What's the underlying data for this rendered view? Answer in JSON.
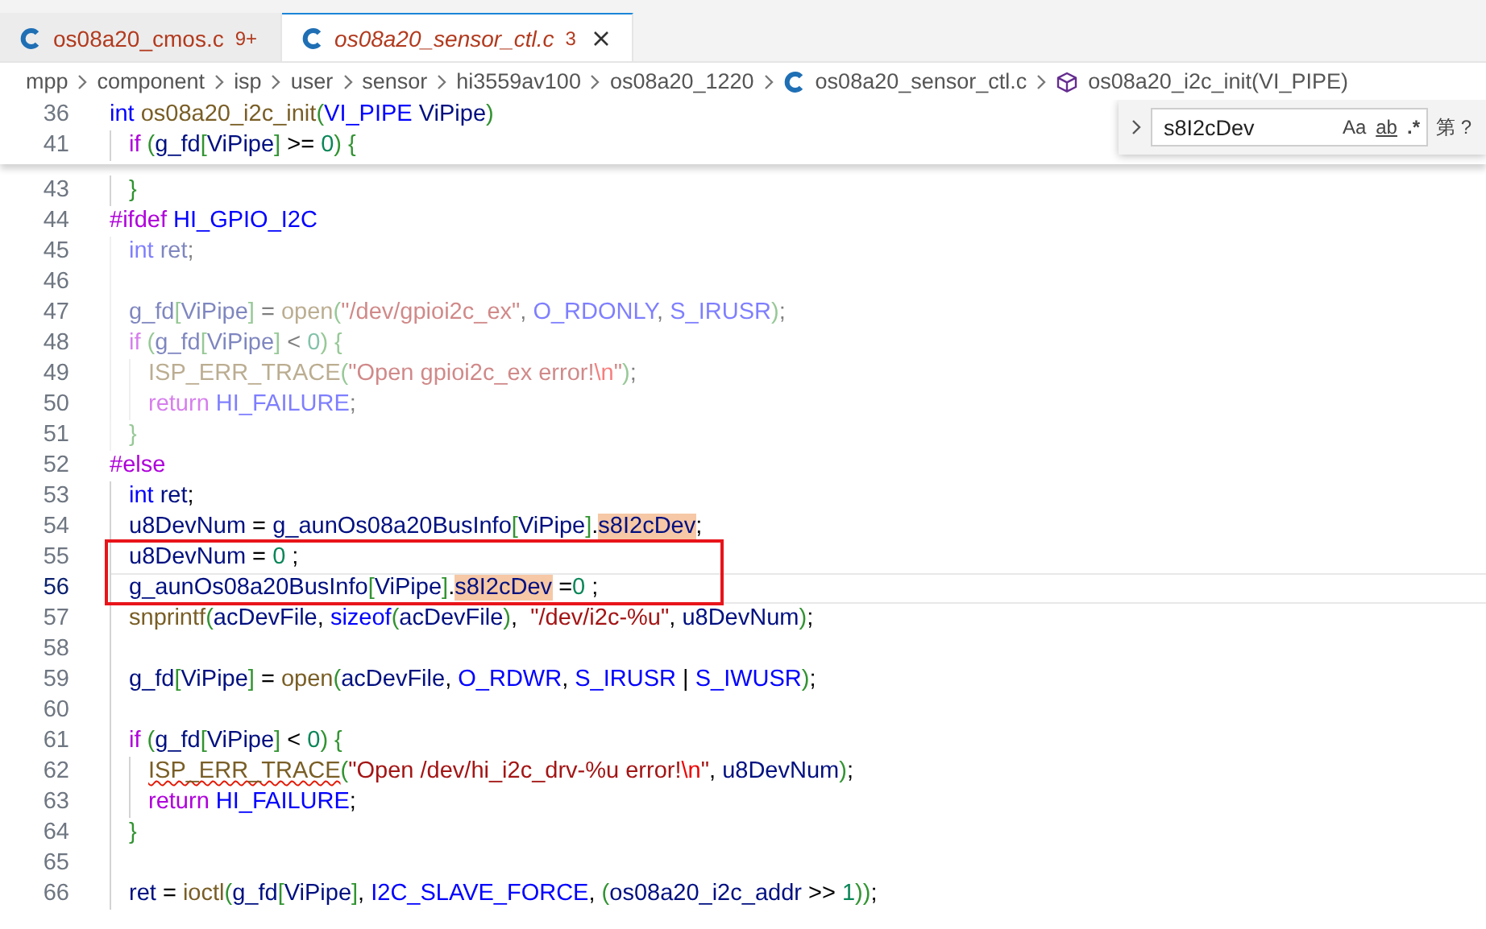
{
  "tabs": [
    {
      "label": "os08a20_cmos.c",
      "problems": "9+",
      "selected": false,
      "preview": false
    },
    {
      "label": "os08a20_sensor_ctl.c",
      "problems": "3",
      "selected": true,
      "preview": true
    }
  ],
  "breadcrumb": [
    {
      "label": "mpp",
      "kind": "folder"
    },
    {
      "label": "component",
      "kind": "folder"
    },
    {
      "label": "isp",
      "kind": "folder"
    },
    {
      "label": "user",
      "kind": "folder"
    },
    {
      "label": "sensor",
      "kind": "folder"
    },
    {
      "label": "hi3559av100",
      "kind": "folder"
    },
    {
      "label": "os08a20_1220",
      "kind": "folder"
    },
    {
      "label": "os08a20_sensor_ctl.c",
      "kind": "file"
    },
    {
      "label": "os08a20_i2c_init(VI_PIPE)",
      "kind": "symbol"
    }
  ],
  "sticky_lines": [
    {
      "number": "36",
      "kind": "top",
      "tokens": [
        {
          "text": "int ",
          "kind": "kw"
        },
        {
          "text": "os08a20_i2c_init",
          "kind": "fn"
        },
        {
          "text": "(",
          "kind": "br"
        },
        {
          "text": "VI_PIPE ",
          "kind": "const"
        },
        {
          "text": "ViPipe",
          "kind": "var"
        },
        {
          "text": ")",
          "kind": "br"
        }
      ]
    },
    {
      "number": "41",
      "kind": "block",
      "tokens": [
        {
          "text": "if ",
          "kind": "ctrl"
        },
        {
          "text": "(",
          "kind": "br"
        },
        {
          "text": "g_fd",
          "kind": "var"
        },
        {
          "text": "[",
          "kind": "br"
        },
        {
          "text": "ViPipe",
          "kind": "var"
        },
        {
          "text": "]",
          "kind": "br"
        },
        {
          "text": " >= ",
          "kind": "p"
        },
        {
          "text": "0",
          "kind": "num"
        },
        {
          "text": ")",
          "kind": "br"
        },
        {
          "text": " {",
          "kind": "br"
        }
      ]
    }
  ],
  "lines": [
    {
      "number": "43",
      "kind": "block",
      "inactive": false,
      "current": false,
      "boxed": false,
      "tokens": [
        {
          "text": "}",
          "kind": "br"
        }
      ]
    },
    {
      "number": "44",
      "kind": "top",
      "inactive": false,
      "current": false,
      "boxed": false,
      "tokens": [
        {
          "text": "#ifdef ",
          "kind": "ctrl"
        },
        {
          "text": "HI_GPIO_I2C",
          "kind": "const"
        }
      ]
    },
    {
      "number": "45",
      "kind": "block",
      "inactive": true,
      "current": false,
      "boxed": false,
      "tokens": [
        {
          "text": "int ",
          "kind": "kw"
        },
        {
          "text": "ret",
          "kind": "var"
        },
        {
          "text": ";",
          "kind": "p"
        }
      ]
    },
    {
      "number": "46",
      "kind": "block",
      "inactive": true,
      "current": false,
      "boxed": false
    },
    {
      "number": "47",
      "kind": "block",
      "inactive": true,
      "current": false,
      "boxed": false,
      "tokens": [
        {
          "text": "g_fd",
          "kind": "var"
        },
        {
          "text": "[",
          "kind": "br"
        },
        {
          "text": "ViPipe",
          "kind": "var"
        },
        {
          "text": "]",
          "kind": "br"
        },
        {
          "text": " = ",
          "kind": "p"
        },
        {
          "text": "open",
          "kind": "fn"
        },
        {
          "text": "(",
          "kind": "br"
        },
        {
          "text": "\"/dev/gpioi2c_ex\"",
          "kind": "str"
        },
        {
          "text": ", ",
          "kind": "p"
        },
        {
          "text": "O_RDONLY",
          "kind": "const"
        },
        {
          "text": ", ",
          "kind": "p"
        },
        {
          "text": "S_IRUSR",
          "kind": "const"
        },
        {
          "text": ")",
          "kind": "br"
        },
        {
          "text": ";",
          "kind": "p"
        }
      ]
    },
    {
      "number": "48",
      "kind": "block",
      "inactive": true,
      "current": false,
      "boxed": false,
      "tokens": [
        {
          "text": "if ",
          "kind": "ctrl"
        },
        {
          "text": "(",
          "kind": "br"
        },
        {
          "text": "g_fd",
          "kind": "var"
        },
        {
          "text": "[",
          "kind": "br"
        },
        {
          "text": "ViPipe",
          "kind": "var"
        },
        {
          "text": "]",
          "kind": "br"
        },
        {
          "text": " < ",
          "kind": "p"
        },
        {
          "text": "0",
          "kind": "num"
        },
        {
          "text": ")",
          "kind": "br"
        },
        {
          "text": " {",
          "kind": "br"
        }
      ]
    },
    {
      "number": "49",
      "kind": "inner",
      "inactive": true,
      "current": false,
      "boxed": false,
      "tokens": [
        {
          "text": "ISP_ERR_TRACE",
          "kind": "fn"
        },
        {
          "text": "(",
          "kind": "br"
        },
        {
          "text": "\"Open gpioi2c_ex error!",
          "kind": "str"
        },
        {
          "text": "\\n",
          "kind": "esc"
        },
        {
          "text": "\"",
          "kind": "str"
        },
        {
          "text": ")",
          "kind": "br"
        },
        {
          "text": ";",
          "kind": "p"
        }
      ]
    },
    {
      "number": "50",
      "kind": "inner",
      "inactive": true,
      "current": false,
      "boxed": false,
      "tokens": [
        {
          "text": "return ",
          "kind": "ctrl"
        },
        {
          "text": "HI_FAILURE",
          "kind": "const"
        },
        {
          "text": ";",
          "kind": "p"
        }
      ]
    },
    {
      "number": "51",
      "kind": "block",
      "inactive": true,
      "current": false,
      "boxed": false,
      "tokens": [
        {
          "text": "}",
          "kind": "br"
        }
      ]
    },
    {
      "number": "52",
      "kind": "top",
      "inactive": false,
      "current": false,
      "boxed": false,
      "tokens": [
        {
          "text": "#else",
          "kind": "ctrl"
        }
      ]
    },
    {
      "number": "53",
      "kind": "block",
      "inactive": false,
      "current": false,
      "boxed": false,
      "tokens": [
        {
          "text": "int ",
          "kind": "kw"
        },
        {
          "text": "ret",
          "kind": "var"
        },
        {
          "text": ";",
          "kind": "p"
        }
      ]
    },
    {
      "number": "54",
      "kind": "block",
      "inactive": false,
      "current": false,
      "boxed": false,
      "tokens": [
        {
          "text": "u8DevNum",
          "kind": "var"
        },
        {
          "text": " = ",
          "kind": "p"
        },
        {
          "text": "g_aunOs08a20BusInfo",
          "kind": "var"
        },
        {
          "text": "[",
          "kind": "br"
        },
        {
          "text": "ViPipe",
          "kind": "var"
        },
        {
          "text": "]",
          "kind": "br"
        },
        {
          "text": ".",
          "kind": "p"
        },
        {
          "text": "s8I2cDev",
          "kind": "var",
          "search_match": true
        },
        {
          "text": ";",
          "kind": "p"
        }
      ]
    },
    {
      "number": "55",
      "kind": "block",
      "inactive": false,
      "current": false,
      "boxed": true,
      "tokens": [
        {
          "text": "u8DevNum",
          "kind": "var"
        },
        {
          "text": " = ",
          "kind": "p"
        },
        {
          "text": "0",
          "kind": "num"
        },
        {
          "text": " ;",
          "kind": "p"
        }
      ]
    },
    {
      "number": "56",
      "kind": "block",
      "inactive": false,
      "current": true,
      "boxed": true,
      "tokens": [
        {
          "text": "g_aunOs08a20BusInfo",
          "kind": "var"
        },
        {
          "text": "[",
          "kind": "br"
        },
        {
          "text": "ViPipe",
          "kind": "var"
        },
        {
          "text": "]",
          "kind": "br"
        },
        {
          "text": ".",
          "kind": "p"
        },
        {
          "text": "s8I2cDev",
          "kind": "var",
          "search_match": true
        },
        {
          "text": " =",
          "kind": "p"
        },
        {
          "text": "0",
          "kind": "num"
        },
        {
          "text": " ;",
          "kind": "p"
        }
      ]
    },
    {
      "number": "57",
      "kind": "block",
      "inactive": false,
      "current": false,
      "boxed": false,
      "tokens": [
        {
          "text": "snprintf",
          "kind": "fn"
        },
        {
          "text": "(",
          "kind": "br"
        },
        {
          "text": "acDevFile",
          "kind": "var"
        },
        {
          "text": ", ",
          "kind": "p"
        },
        {
          "text": "sizeof",
          "kind": "kw"
        },
        {
          "text": "(",
          "kind": "br"
        },
        {
          "text": "acDevFile",
          "kind": "var"
        },
        {
          "text": ")",
          "kind": "br"
        },
        {
          "text": ",  ",
          "kind": "p"
        },
        {
          "text": "\"/dev/i2c-%u\"",
          "kind": "str"
        },
        {
          "text": ", ",
          "kind": "p"
        },
        {
          "text": "u8DevNum",
          "kind": "var"
        },
        {
          "text": ")",
          "kind": "br"
        },
        {
          "text": ";",
          "kind": "p"
        }
      ]
    },
    {
      "number": "58",
      "kind": "block",
      "inactive": false,
      "current": false,
      "boxed": false
    },
    {
      "number": "59",
      "kind": "block",
      "inactive": false,
      "current": false,
      "boxed": false,
      "tokens": [
        {
          "text": "g_fd",
          "kind": "var"
        },
        {
          "text": "[",
          "kind": "br"
        },
        {
          "text": "ViPipe",
          "kind": "var"
        },
        {
          "text": "]",
          "kind": "br"
        },
        {
          "text": " = ",
          "kind": "p"
        },
        {
          "text": "open",
          "kind": "fn"
        },
        {
          "text": "(",
          "kind": "br"
        },
        {
          "text": "acDevFile",
          "kind": "var"
        },
        {
          "text": ", ",
          "kind": "p"
        },
        {
          "text": "O_RDWR",
          "kind": "const"
        },
        {
          "text": ", ",
          "kind": "p"
        },
        {
          "text": "S_IRUSR",
          "kind": "const"
        },
        {
          "text": " | ",
          "kind": "p"
        },
        {
          "text": "S_IWUSR",
          "kind": "const"
        },
        {
          "text": ")",
          "kind": "br"
        },
        {
          "text": ";",
          "kind": "p"
        }
      ]
    },
    {
      "number": "60",
      "kind": "block",
      "inactive": false,
      "current": false,
      "boxed": false
    },
    {
      "number": "61",
      "kind": "block",
      "inactive": false,
      "current": false,
      "boxed": false,
      "tokens": [
        {
          "text": "if ",
          "kind": "ctrl"
        },
        {
          "text": "(",
          "kind": "br"
        },
        {
          "text": "g_fd",
          "kind": "var"
        },
        {
          "text": "[",
          "kind": "br"
        },
        {
          "text": "ViPipe",
          "kind": "var"
        },
        {
          "text": "]",
          "kind": "br"
        },
        {
          "text": " < ",
          "kind": "p"
        },
        {
          "text": "0",
          "kind": "num"
        },
        {
          "text": ")",
          "kind": "br"
        },
        {
          "text": " {",
          "kind": "br"
        }
      ]
    },
    {
      "number": "62",
      "kind": "inner",
      "inactive": false,
      "current": false,
      "boxed": false,
      "tokens": [
        {
          "text": "ISP_ERR_TRACE",
          "kind": "fn",
          "error": true
        },
        {
          "text": "(",
          "kind": "br"
        },
        {
          "text": "\"Open /dev/hi_i2c_drv-%u error!",
          "kind": "str"
        },
        {
          "text": "\\n",
          "kind": "esc"
        },
        {
          "text": "\"",
          "kind": "str"
        },
        {
          "text": ", ",
          "kind": "p"
        },
        {
          "text": "u8DevNum",
          "kind": "var"
        },
        {
          "text": ")",
          "kind": "br"
        },
        {
          "text": ";",
          "kind": "p"
        }
      ]
    },
    {
      "number": "63",
      "kind": "inner",
      "inactive": false,
      "current": false,
      "boxed": false,
      "tokens": [
        {
          "text": "return ",
          "kind": "ctrl"
        },
        {
          "text": "HI_FAILURE",
          "kind": "const"
        },
        {
          "text": ";",
          "kind": "p"
        }
      ]
    },
    {
      "number": "64",
      "kind": "block",
      "inactive": false,
      "current": false,
      "boxed": false,
      "tokens": [
        {
          "text": "}",
          "kind": "br"
        }
      ]
    },
    {
      "number": "65",
      "kind": "block",
      "inactive": false,
      "current": false,
      "boxed": false
    },
    {
      "number": "66",
      "kind": "block",
      "inactive": false,
      "current": false,
      "boxed": false,
      "tokens": [
        {
          "text": "ret",
          "kind": "var"
        },
        {
          "text": " = ",
          "kind": "p"
        },
        {
          "text": "ioctl",
          "kind": "fn"
        },
        {
          "text": "(",
          "kind": "br"
        },
        {
          "text": "g_fd",
          "kind": "var"
        },
        {
          "text": "[",
          "kind": "br"
        },
        {
          "text": "ViPipe",
          "kind": "var"
        },
        {
          "text": "]",
          "kind": "br"
        },
        {
          "text": ", ",
          "kind": "p"
        },
        {
          "text": "I2C_SLAVE_FORCE",
          "kind": "const"
        },
        {
          "text": ", ",
          "kind": "p"
        },
        {
          "text": "(",
          "kind": "br"
        },
        {
          "text": "os08a20_i2c_addr",
          "kind": "var"
        },
        {
          "text": " >> ",
          "kind": "p"
        },
        {
          "text": "1",
          "kind": "num"
        },
        {
          "text": "))",
          "kind": "br"
        },
        {
          "text": ";",
          "kind": "p"
        }
      ]
    }
  ],
  "find_widget": {
    "value": "s8I2cDev",
    "options": [
      {
        "label": "Aa",
        "kind": "case"
      },
      {
        "label": "ab",
        "kind": "word"
      },
      {
        "label": ".*",
        "kind": "regex"
      }
    ],
    "status": "第 ?"
  }
}
